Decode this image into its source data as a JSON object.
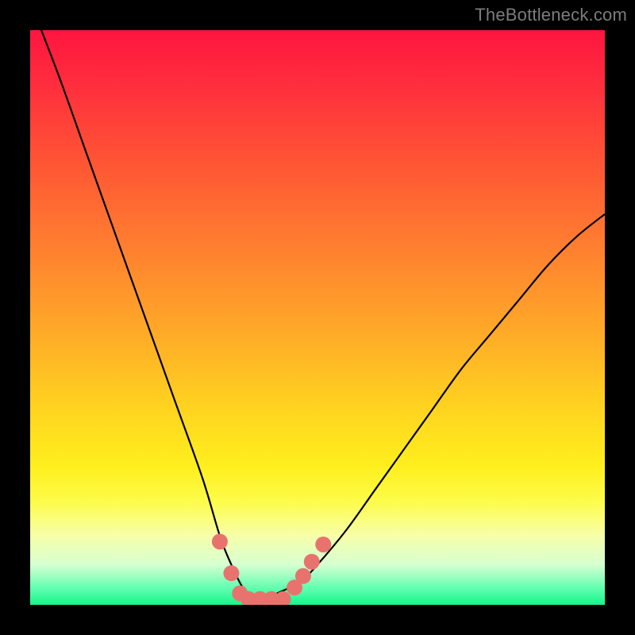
{
  "watermark": "TheBottleneck.com",
  "chart_data": {
    "type": "line",
    "title": "",
    "xlabel": "",
    "ylabel": "",
    "xlim": [
      0,
      100
    ],
    "ylim": [
      0,
      100
    ],
    "grid": false,
    "series": [
      {
        "name": "bottleneck-curve",
        "x": [
          0,
          5,
          10,
          15,
          20,
          25,
          30,
          33,
          35,
          37,
          39,
          41,
          43,
          47,
          50,
          55,
          60,
          65,
          70,
          75,
          80,
          85,
          90,
          95,
          100
        ],
        "y": [
          105,
          92,
          78,
          64,
          50,
          36,
          22,
          12,
          7,
          3,
          1,
          1,
          2,
          4,
          7,
          13,
          20,
          27,
          34,
          41,
          47,
          53,
          59,
          64,
          68
        ]
      }
    ],
    "markers": {
      "name": "highlight-dots",
      "color": "#e8736e",
      "points": [
        {
          "x": 33.0,
          "y": 11.0
        },
        {
          "x": 35.0,
          "y": 5.5
        },
        {
          "x": 36.5,
          "y": 2.0
        },
        {
          "x": 38.0,
          "y": 1.0
        },
        {
          "x": 40.0,
          "y": 1.0
        },
        {
          "x": 42.0,
          "y": 1.0
        },
        {
          "x": 44.0,
          "y": 1.0
        },
        {
          "x": 46.0,
          "y": 3.0
        },
        {
          "x": 47.5,
          "y": 5.0
        },
        {
          "x": 49.0,
          "y": 7.5
        },
        {
          "x": 51.0,
          "y": 10.5
        }
      ]
    },
    "background": {
      "type": "vertical-gradient",
      "stops": [
        {
          "pos": 0.0,
          "color": "#ff153f"
        },
        {
          "pos": 0.5,
          "color": "#ffa627"
        },
        {
          "pos": 0.8,
          "color": "#fff848"
        },
        {
          "pos": 1.0,
          "color": "#17f58a"
        }
      ]
    }
  }
}
